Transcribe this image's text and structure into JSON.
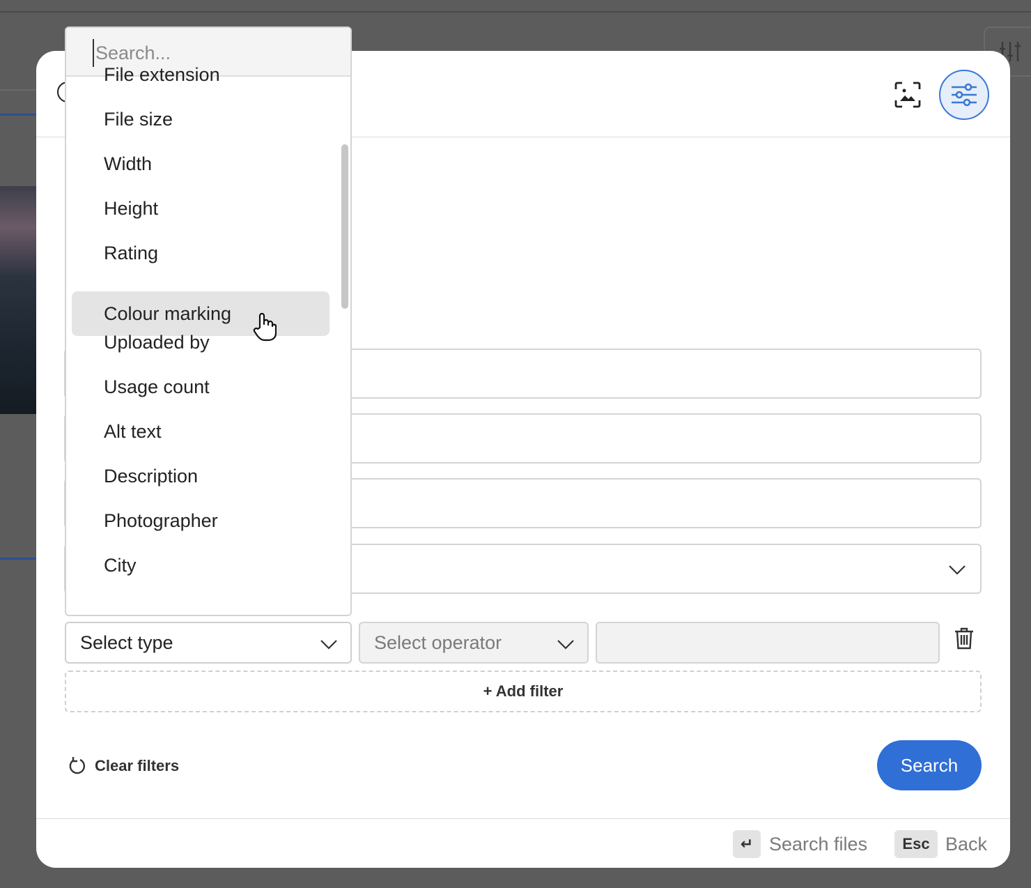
{
  "dropdown": {
    "search_placeholder": "Search...",
    "items": [
      {
        "label": "File extension"
      },
      {
        "label": "File size"
      },
      {
        "label": "Width"
      },
      {
        "label": "Height"
      },
      {
        "label": "Rating"
      },
      {
        "label": "Colour marking",
        "hovered": true
      },
      {
        "label": "Uploaded by"
      },
      {
        "label": "Usage count"
      },
      {
        "label": "Alt text"
      },
      {
        "label": "Description"
      },
      {
        "label": "Photographer"
      },
      {
        "label": "City"
      }
    ]
  },
  "filter_row": {
    "type_placeholder": "Select type",
    "operator_placeholder": "Select operator"
  },
  "actions": {
    "add_filter": "+ Add filter",
    "clear_filters": "Clear filters",
    "search": "Search"
  },
  "footer": {
    "enter_key": "↵",
    "enter_label": "Search files",
    "esc_key": "Esc",
    "esc_label": "Back"
  },
  "colors": {
    "accent": "#2f6fd6",
    "overlay": "#5c5c5c",
    "hover_item": "#e4e4e4"
  },
  "icons": {
    "header_left": "circle-icon",
    "image_search": "image-search-icon",
    "filter": "sliders-icon",
    "chevron": "chevron-down-icon",
    "trash": "trash-icon",
    "reset": "reset-icon",
    "cursor": "hand-cursor-icon"
  }
}
